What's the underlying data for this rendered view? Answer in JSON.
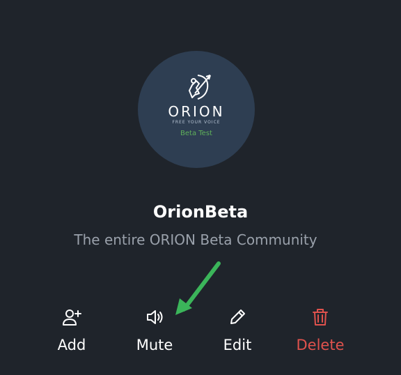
{
  "group": {
    "avatar": {
      "logo_icon": "orion-archer-logo",
      "brand_word": "ORION",
      "tagline": "FREE YOUR VOICE",
      "beta_label": "Beta Test",
      "background_color": "#2e3e52"
    },
    "name": "OrionBeta",
    "description": "The entire ORION Beta Community"
  },
  "actions": [
    {
      "label": "Add",
      "icon": "add-user-icon"
    },
    {
      "label": "Mute",
      "icon": "speaker-icon"
    },
    {
      "label": "Edit",
      "icon": "pencil-icon"
    },
    {
      "label": "Delete",
      "icon": "trash-icon",
      "color": "#e0524d"
    }
  ],
  "annotation": {
    "icon": "green-arrow-icon",
    "color": "#3bb55a"
  },
  "colors": {
    "background": "#1f242b",
    "text": "#ffffff",
    "muted_text": "#9aa1ab",
    "danger": "#e0524d"
  }
}
